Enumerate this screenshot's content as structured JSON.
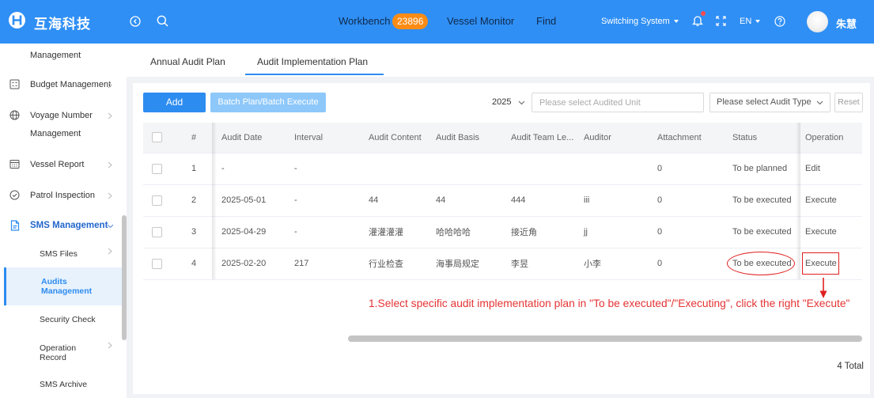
{
  "brand": {
    "logo_text": "互海科技"
  },
  "topbar": {
    "workbench": "Workbench",
    "workbench_badge": "23896",
    "vessel_monitor": "Vessel Monitor",
    "find": "Find",
    "switching_system": "Switching System",
    "language": "EN",
    "user_name": "朱慧"
  },
  "sidebar": {
    "items": [
      {
        "label": "Management"
      },
      {
        "label": "Budget Management",
        "icon": "grid-icon"
      },
      {
        "label": "Voyage Number Management",
        "icon": "globe-icon"
      },
      {
        "label": "Vessel Report",
        "icon": "calendar-icon"
      },
      {
        "label": "Patrol Inspection",
        "icon": "check-circle-icon"
      },
      {
        "label": "SMS Management",
        "icon": "document-icon",
        "expanded": true
      }
    ],
    "sms_children": [
      {
        "label": "SMS Files"
      },
      {
        "label": "Audits Management",
        "active": true
      },
      {
        "label": "Security Check"
      },
      {
        "label": "Operation Record"
      },
      {
        "label": "SMS Archive"
      }
    ]
  },
  "tabs": [
    {
      "label": "Annual Audit Plan",
      "active": false
    },
    {
      "label": "Audit Implementation Plan",
      "active": true
    }
  ],
  "toolbar": {
    "add_label": "Add",
    "batch_label": "Batch Plan/Batch Execute",
    "year_value": "2025",
    "audited_unit_placeholder": "Please select Audited Unit",
    "audit_type_placeholder": "Please select Audit Type",
    "reset_label": "Reset"
  },
  "table": {
    "columns": [
      "#",
      "Audit Date",
      "Interval",
      "Audit Content",
      "Audit Basis",
      "Audit Team Le...",
      "Auditor",
      "Attachment",
      "Status",
      "Operation"
    ],
    "rows": [
      {
        "no": "1",
        "date": "-",
        "interval": "-",
        "content": "",
        "basis": "",
        "leader": "",
        "auditor": "",
        "attachment": "0",
        "status": "To be planned",
        "operation": "Edit"
      },
      {
        "no": "2",
        "date": "2025-05-01",
        "interval": "-",
        "content": "44",
        "basis": "44",
        "leader": "444",
        "auditor": "iii",
        "attachment": "0",
        "status": "To be executed",
        "operation": "Execute"
      },
      {
        "no": "3",
        "date": "2025-04-29",
        "interval": "-",
        "content": "灌灌灌灌",
        "basis": "哈哈哈哈",
        "leader": "接近角",
        "auditor": "jj",
        "attachment": "0",
        "status": "To be executed",
        "operation": "Execute"
      },
      {
        "no": "4",
        "date": "2025-02-20",
        "interval": "217",
        "content": "行业检查",
        "basis": "海事局规定",
        "leader": "李昱",
        "auditor": "小李",
        "attachment": "0",
        "status": "To be executed",
        "operation": "Execute"
      }
    ]
  },
  "pagination": {
    "total_text": "4 Total"
  },
  "annotation": {
    "step_text": "1.Select specific audit implementation plan in \"To be executed\"/\"Executing\", click the right \"Execute\""
  },
  "colors": {
    "primary": "#2d8cf0",
    "topbar": "#2f8ff5",
    "badge": "#fa8c16",
    "annotation": "#e02020",
    "active_menu_bg": "#e8f2fd"
  }
}
